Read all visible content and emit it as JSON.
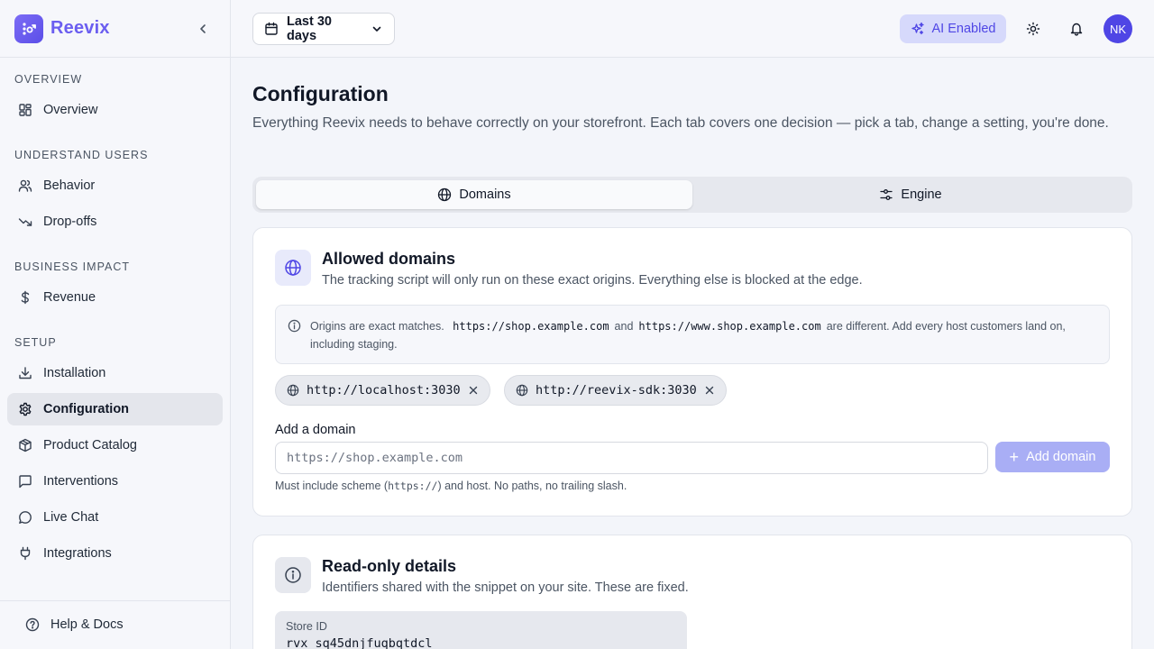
{
  "brand": {
    "name": "Reevix"
  },
  "sidebar": {
    "sections": [
      {
        "label": "OVERVIEW"
      },
      {
        "label": "UNDERSTAND USERS"
      },
      {
        "label": "BUSINESS IMPACT"
      },
      {
        "label": "SETUP"
      }
    ],
    "items": [
      {
        "label": "Overview",
        "icon": "grid-icon"
      },
      {
        "label": "Behavior",
        "icon": "users-icon"
      },
      {
        "label": "Drop-offs",
        "icon": "trending-down-icon"
      },
      {
        "label": "Revenue",
        "icon": "dollar-icon"
      },
      {
        "label": "Installation",
        "icon": "download-icon"
      },
      {
        "label": "Configuration",
        "icon": "gear-icon",
        "active": true
      },
      {
        "label": "Product Catalog",
        "icon": "package-icon"
      },
      {
        "label": "Interventions",
        "icon": "message-square-icon"
      },
      {
        "label": "Live Chat",
        "icon": "message-circle-icon"
      },
      {
        "label": "Integrations",
        "icon": "plug-icon"
      }
    ],
    "footer": {
      "label": "Help & Docs",
      "icon": "help-circle-icon"
    }
  },
  "topbar": {
    "date_range": "Last 30 days",
    "ai_badge": "AI Enabled",
    "avatar_initials": "NK"
  },
  "page": {
    "title": "Configuration",
    "description": "Everything Reevix needs to behave correctly on your storefront. Each tab covers one decision — pick a tab, change a setting, you're done."
  },
  "tabs": [
    {
      "label": "Domains",
      "icon": "globe-icon",
      "active": true
    },
    {
      "label": "Engine",
      "icon": "sliders-icon",
      "active": false
    }
  ],
  "allowed_domains": {
    "title": "Allowed domains",
    "subtitle": "The tracking script will only run on these exact origins. Everything else is blocked at the edge.",
    "note": {
      "prefix": "Origins are exact matches.",
      "code1": "https://shop.example.com",
      "and": "and",
      "code2": "https://www.shop.example.com",
      "suffix": "are different. Add every host customers land on, including staging."
    },
    "domains": [
      "http://localhost:3030",
      "http://reevix-sdk:3030"
    ],
    "add_label": "Add a domain",
    "input_placeholder": "https://shop.example.com",
    "input_value": "",
    "add_button": "Add domain",
    "hint_prefix": "Must include scheme (",
    "hint_code": "https://",
    "hint_suffix": ") and host. No paths, no trailing slash."
  },
  "readonly": {
    "title": "Read-only details",
    "subtitle": "Identifiers shared with the snippet on your site. These are fixed.",
    "store_id_label": "Store ID",
    "store_id_value": "rvx_sq45dnjfuqbqtdcl"
  },
  "colors": {
    "accent": "#5b4ee8",
    "brand_text": "#6b5ef0",
    "ai_badge_bg": "#d6d9fb",
    "add_button_disabled": "#a9aef5"
  }
}
